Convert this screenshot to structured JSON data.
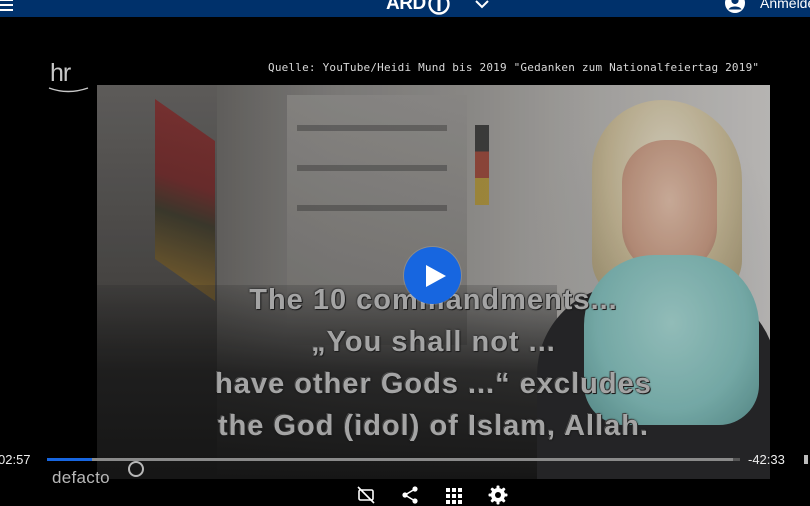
{
  "header": {
    "menu_icon": "hamburger-menu-icon",
    "logo_text": "ARD",
    "logo_icon": "ard-one-icon",
    "dropdown_icon": "chevron-down-icon",
    "account_icon": "user-circle-icon",
    "account_label": "Anmelden",
    "bg_color": "#00316b"
  },
  "player": {
    "broadcaster_logo": "hr",
    "source_text": "Quelle: YouTube/Heidi Mund bis 2019 \"Gedanken zum Nationalfeiertag 2019\"",
    "subtitle_lines": [
      "The 10 commandments...",
      "„You shall not ...",
      "have other Gods ...“ excludes",
      "the God (idol) of Islam, Allah."
    ],
    "play_icon": "play-icon",
    "accent_color": "#1766e0",
    "time_elapsed": "02:57",
    "time_remaining": "-42:33",
    "progress": 0.065,
    "buffered": 0.99,
    "show_label": "defacto",
    "controls": [
      {
        "name": "subtitles-off-icon"
      },
      {
        "name": "share-icon"
      },
      {
        "name": "grid-icon"
      },
      {
        "name": "settings-gear-icon"
      }
    ]
  }
}
